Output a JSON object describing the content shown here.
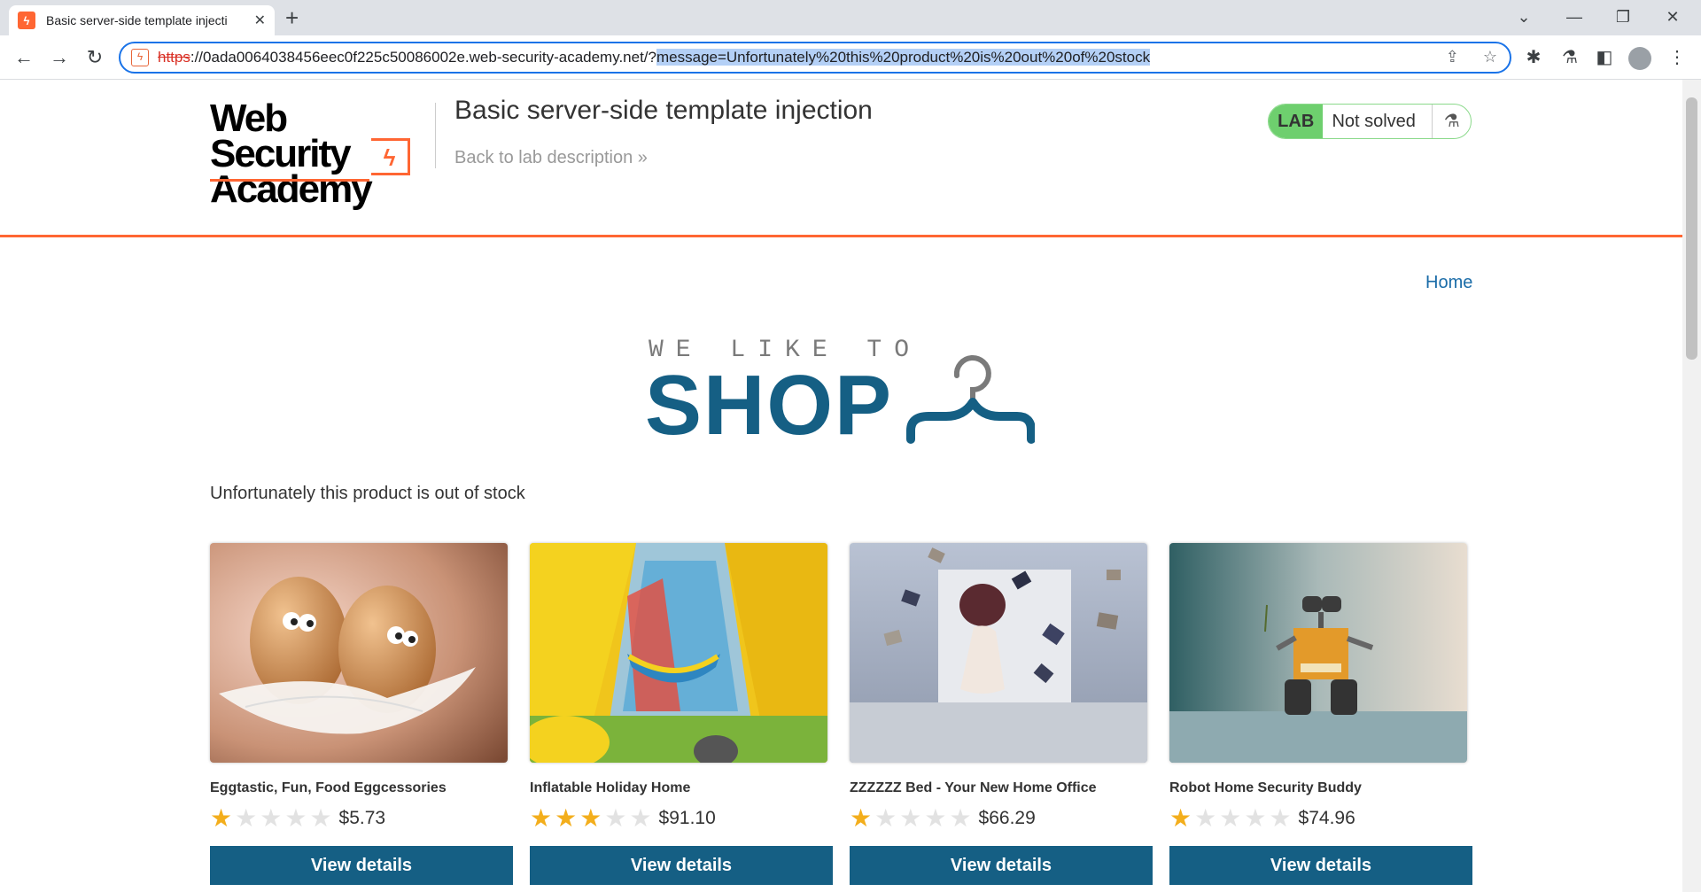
{
  "browser": {
    "tab_title": "Basic server-side template injecti",
    "url_scheme": "https",
    "url_host": "://0ada0064038456eec0f225c50086002e.web-security-academy.net/?",
    "url_query": "message=Unfortunately%20this%20product%20is%20out%20of%20stock"
  },
  "header": {
    "logo_line1": "Web Security",
    "logo_line2": "Academy",
    "lab_title": "Basic server-side template injection",
    "back_link": "Back to lab description",
    "lab_tag": "LAB",
    "lab_state": "Not solved"
  },
  "nav": {
    "home": "Home"
  },
  "shop_logo": {
    "small": "WE LIKE TO",
    "big": "SHOP"
  },
  "message": "Unfortunately this product is out of stock",
  "products": [
    {
      "name": "Eggtastic, Fun, Food Eggcessories",
      "rating": 1,
      "price": "$5.73",
      "button": "View details"
    },
    {
      "name": "Inflatable Holiday Home",
      "rating": 3,
      "price": "$91.10",
      "button": "View details"
    },
    {
      "name": "ZZZZZZ Bed - Your New Home Office",
      "rating": 1,
      "price": "$66.29",
      "button": "View details"
    },
    {
      "name": "Robot Home Security Buddy",
      "rating": 1,
      "price": "$74.96",
      "button": "View details"
    }
  ],
  "colors": {
    "brand_orange": "#ff6633",
    "shop_blue": "#155f84",
    "link_blue": "#1a6ca8",
    "star_gold": "#f3ae1c",
    "lab_green": "#6ecf6e"
  }
}
